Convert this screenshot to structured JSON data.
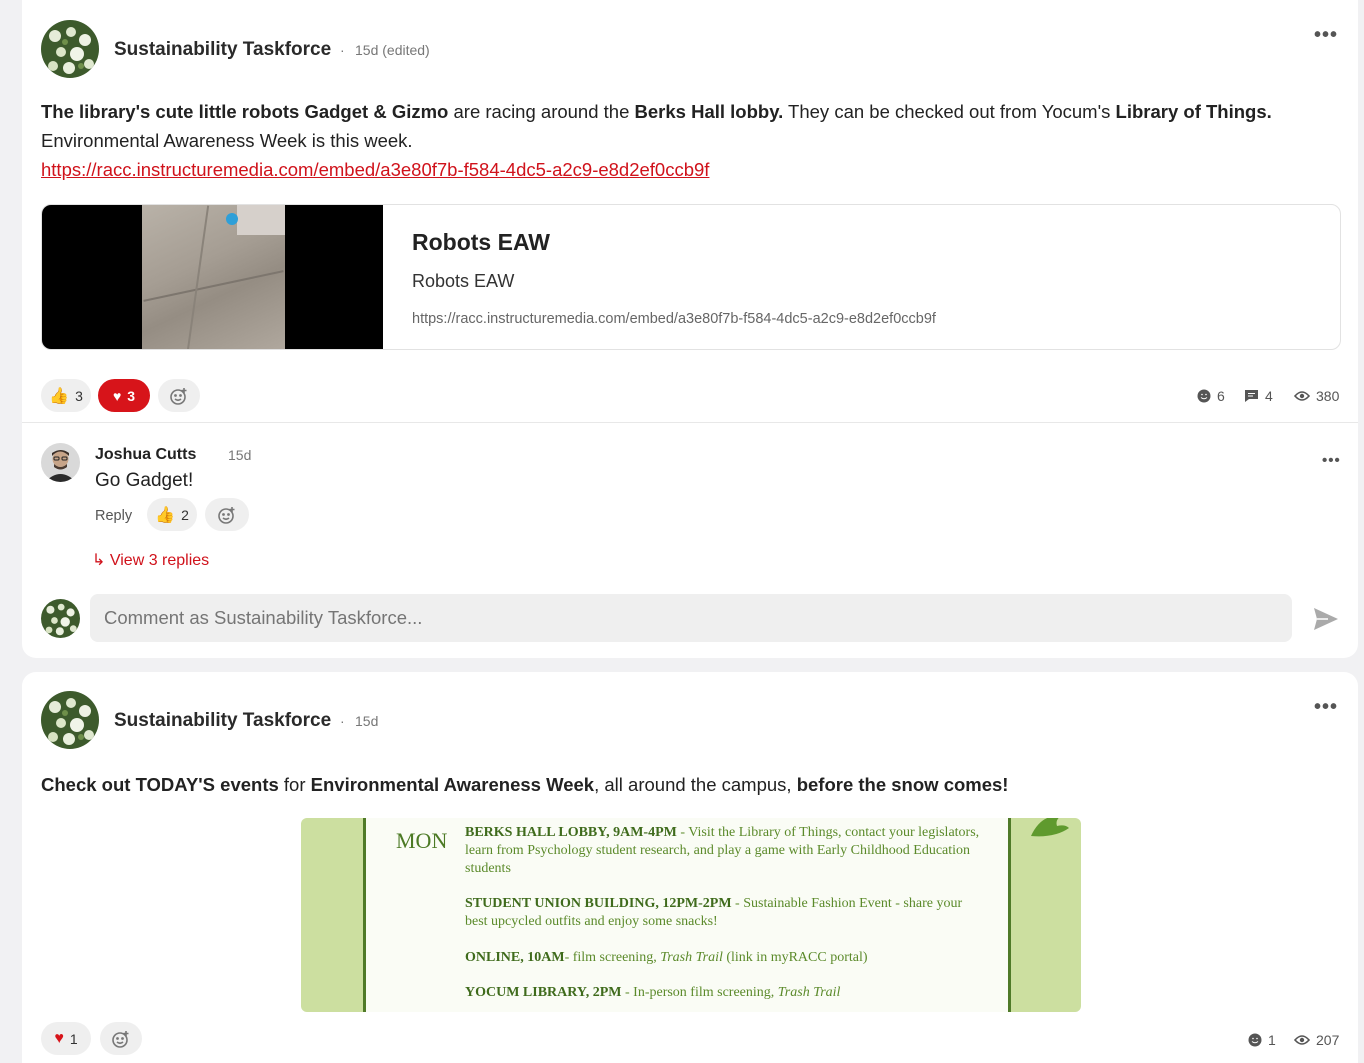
{
  "post1": {
    "author": "Sustainability Taskforce",
    "separator": "·",
    "time": "15d (edited)",
    "more": "•••",
    "text": {
      "b1": "The library's cute little robots Gadget & Gizmo",
      "t1": " are racing around the ",
      "b2": "Berks Hall lobby.",
      "t2": " They can be checked out from Yocum's ",
      "b3": "Library of Things.",
      "t3": "Environmental Awareness Week is this week."
    },
    "link": "https://racc.instructuremedia.com/embed/a3e80f7b-f584-4dc5-a2c9-e8d2ef0ccb9f",
    "preview": {
      "title": "Robots EAW",
      "subtitle": "Robots EAW",
      "url": "https://racc.instructuremedia.com/embed/a3e80f7b-f584-4dc5-a2c9-e8d2ef0ccb9f"
    },
    "reactions": {
      "thumbs_up": "3",
      "heart": "3"
    },
    "stats": {
      "reactors": "6",
      "comments": "4",
      "views": "380"
    },
    "comment": {
      "author": "Joshua Cutts",
      "time": "15d",
      "text": "Go Gadget!",
      "reply_label": "Reply",
      "thumbs_up": "2",
      "more": "•••"
    },
    "view_replies": "↳ View 3 replies",
    "comment_placeholder": "Comment as Sustainability Taskforce..."
  },
  "post2": {
    "author": "Sustainability Taskforce",
    "separator": "·",
    "time": "15d",
    "more": "•••",
    "text": {
      "b1": "Check out TODAY'S events",
      "t1": " for ",
      "b2": "Environmental Awareness Week",
      "t2": ", all around the campus, ",
      "b3": "before the snow comes!"
    },
    "poster": {
      "day": "MON",
      "ev1_b": "BERKS HALL LOBBY, 9AM-4PM",
      "ev1_t": " - Visit the Library of Things, contact your legislators, learn from Psychology student research,  and play a game with Early Childhood Education students",
      "ev2_b": "STUDENT UNION BUILDING, 12PM-2PM",
      "ev2_t": " - Sustainable Fashion Event - share your best upcycled outfits and enjoy some snacks!",
      "ev3_b": "ONLINE, 10AM",
      "ev3_t1": "- film screening, ",
      "ev3_i": "Trash Trail",
      "ev3_t2": " (link in myRACC portal)",
      "ev4_b": "YOCUM LIBRARY, 2PM",
      "ev4_t": " - In-person film screening, ",
      "ev4_i": "Trash Trail"
    },
    "reactions": {
      "heart": "1"
    },
    "stats": {
      "reactors": "1",
      "views": "207"
    }
  },
  "colors": {
    "accent": "#d7141a",
    "link": "#d0121b",
    "poster_green": "#ccdfa0"
  },
  "icons": [
    "thumbs-up-emoji",
    "heart-emoji",
    "add-reaction-icon",
    "reactors-icon",
    "comments-icon",
    "views-icon",
    "send-icon",
    "more-icon"
  ]
}
